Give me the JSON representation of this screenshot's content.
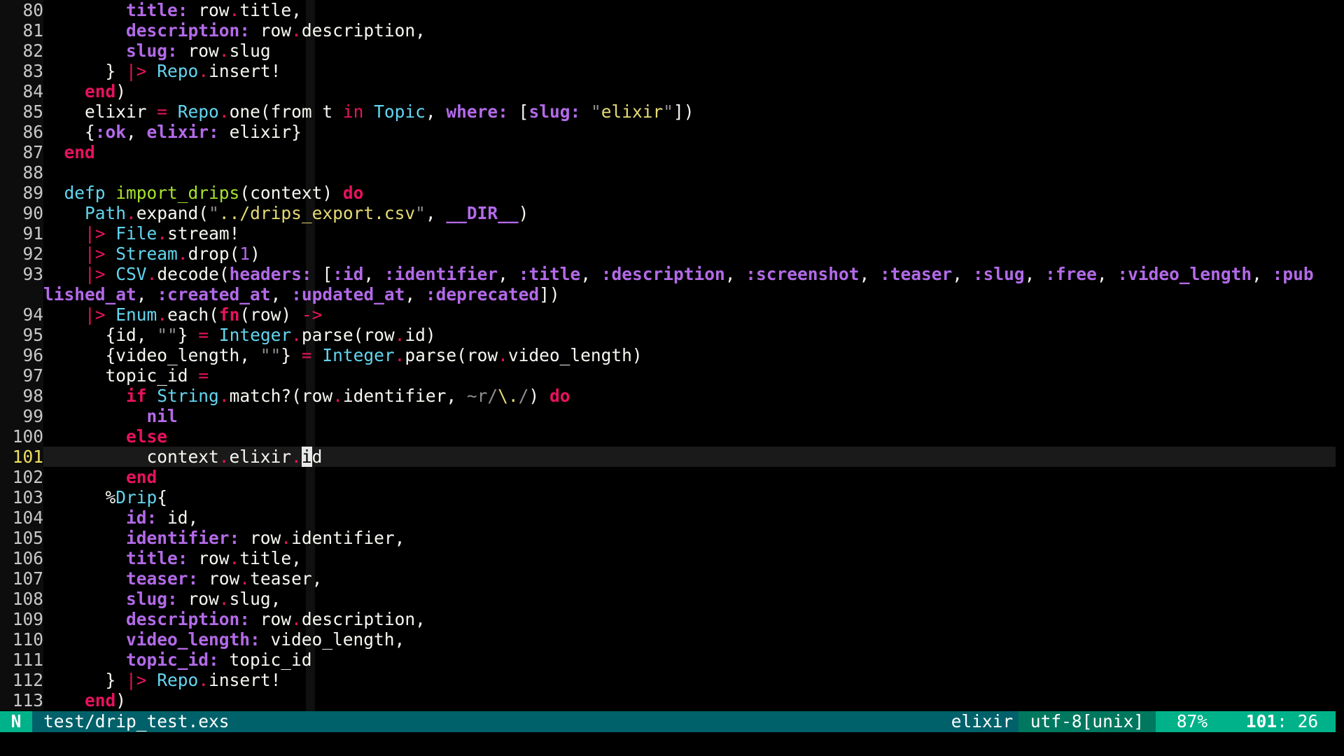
{
  "lines": [
    {
      "num": "80",
      "parts": [
        [
          "txt",
          "        "
        ],
        [
          "key",
          "title:"
        ],
        [
          "txt",
          " row"
        ],
        [
          "dot",
          "."
        ],
        [
          "txt",
          "title,"
        ]
      ]
    },
    {
      "num": "81",
      "parts": [
        [
          "txt",
          "        "
        ],
        [
          "key",
          "description:"
        ],
        [
          "txt",
          " row"
        ],
        [
          "dot",
          "."
        ],
        [
          "txt",
          "description,"
        ]
      ]
    },
    {
      "num": "82",
      "parts": [
        [
          "txt",
          "        "
        ],
        [
          "key",
          "slug:"
        ],
        [
          "txt",
          " row"
        ],
        [
          "dot",
          "."
        ],
        [
          "txt",
          "slug"
        ]
      ]
    },
    {
      "num": "83",
      "parts": [
        [
          "txt",
          "      } "
        ],
        [
          "op",
          "|>"
        ],
        [
          "txt",
          " "
        ],
        [
          "mod",
          "Repo"
        ],
        [
          "dot",
          "."
        ],
        [
          "txt",
          "insert!"
        ]
      ]
    },
    {
      "num": "84",
      "parts": [
        [
          "txt",
          "    "
        ],
        [
          "kw",
          "end"
        ],
        [
          "txt",
          ")"
        ]
      ]
    },
    {
      "num": "85",
      "parts": [
        [
          "txt",
          "    elixir "
        ],
        [
          "op",
          "="
        ],
        [
          "txt",
          " "
        ],
        [
          "mod",
          "Repo"
        ],
        [
          "dot",
          "."
        ],
        [
          "txt",
          "one(from t "
        ],
        [
          "op",
          "in"
        ],
        [
          "txt",
          " "
        ],
        [
          "mod",
          "Topic"
        ],
        [
          "txt",
          ", "
        ],
        [
          "key",
          "where:"
        ],
        [
          "txt",
          " ["
        ],
        [
          "key",
          "slug:"
        ],
        [
          "txt",
          " "
        ],
        [
          "quote",
          "\""
        ],
        [
          "str",
          "elixir"
        ],
        [
          "quote",
          "\""
        ],
        [
          "txt",
          "])"
        ]
      ]
    },
    {
      "num": "86",
      "parts": [
        [
          "txt",
          "    {"
        ],
        [
          "key",
          ":ok"
        ],
        [
          "txt",
          ", "
        ],
        [
          "key",
          "elixir:"
        ],
        [
          "txt",
          " elixir}"
        ]
      ]
    },
    {
      "num": "87",
      "parts": [
        [
          "txt",
          "  "
        ],
        [
          "kw",
          "end"
        ]
      ]
    },
    {
      "num": "88",
      "parts": []
    },
    {
      "num": "89",
      "parts": [
        [
          "txt",
          "  "
        ],
        [
          "def",
          "defp"
        ],
        [
          "txt",
          " "
        ],
        [
          "fn",
          "import_drips"
        ],
        [
          "txt",
          "(context) "
        ],
        [
          "kw",
          "do"
        ]
      ]
    },
    {
      "num": "90",
      "parts": [
        [
          "txt",
          "    "
        ],
        [
          "mod",
          "Path"
        ],
        [
          "dot",
          "."
        ],
        [
          "txt",
          "expand("
        ],
        [
          "quote",
          "\""
        ],
        [
          "str",
          "../drips_export.csv"
        ],
        [
          "quote",
          "\""
        ],
        [
          "txt",
          ", "
        ],
        [
          "key",
          "__DIR__"
        ],
        [
          "txt",
          ")"
        ]
      ]
    },
    {
      "num": "91",
      "parts": [
        [
          "txt",
          "    "
        ],
        [
          "op",
          "|>"
        ],
        [
          "txt",
          " "
        ],
        [
          "mod",
          "File"
        ],
        [
          "dot",
          "."
        ],
        [
          "txt",
          "stream!"
        ]
      ]
    },
    {
      "num": "92",
      "parts": [
        [
          "txt",
          "    "
        ],
        [
          "op",
          "|>"
        ],
        [
          "txt",
          " "
        ],
        [
          "mod",
          "Stream"
        ],
        [
          "dot",
          "."
        ],
        [
          "txt",
          "drop("
        ],
        [
          "num",
          "1"
        ],
        [
          "txt",
          ")"
        ]
      ]
    },
    {
      "num": "93",
      "parts": [
        [
          "txt",
          "    "
        ],
        [
          "op",
          "|>"
        ],
        [
          "txt",
          " "
        ],
        [
          "mod",
          "CSV"
        ],
        [
          "dot",
          "."
        ],
        [
          "txt",
          "decode("
        ],
        [
          "key",
          "headers:"
        ],
        [
          "txt",
          " ["
        ],
        [
          "key",
          ":id"
        ],
        [
          "txt",
          ", "
        ],
        [
          "key",
          ":identifier"
        ],
        [
          "txt",
          ", "
        ],
        [
          "key",
          ":title"
        ],
        [
          "txt",
          ", "
        ],
        [
          "key",
          ":description"
        ],
        [
          "txt",
          ", "
        ],
        [
          "key",
          ":screenshot"
        ],
        [
          "txt",
          ", "
        ],
        [
          "key",
          ":teaser"
        ],
        [
          "txt",
          ", "
        ],
        [
          "key",
          ":slug"
        ],
        [
          "txt",
          ", "
        ],
        [
          "key",
          ":free"
        ],
        [
          "txt",
          ", "
        ],
        [
          "key",
          ":video_length"
        ],
        [
          "txt",
          ", "
        ],
        [
          "key",
          ":pub"
        ]
      ]
    },
    {
      "num": "",
      "parts": [
        [
          "key",
          "lished_at"
        ],
        [
          "txt",
          ", "
        ],
        [
          "key",
          ":created_at"
        ],
        [
          "txt",
          ", "
        ],
        [
          "key",
          ":updated_at"
        ],
        [
          "txt",
          ", "
        ],
        [
          "key",
          ":deprecated"
        ],
        [
          "txt",
          "])"
        ]
      ]
    },
    {
      "num": "94",
      "parts": [
        [
          "txt",
          "    "
        ],
        [
          "op",
          "|>"
        ],
        [
          "txt",
          " "
        ],
        [
          "mod",
          "Enum"
        ],
        [
          "dot",
          "."
        ],
        [
          "txt",
          "each("
        ],
        [
          "kw",
          "fn"
        ],
        [
          "txt",
          "(row) "
        ],
        [
          "op",
          "->"
        ]
      ]
    },
    {
      "num": "95",
      "parts": [
        [
          "txt",
          "      {id, "
        ],
        [
          "quote",
          "\"\""
        ],
        [
          "txt",
          "} "
        ],
        [
          "op",
          "="
        ],
        [
          "txt",
          " "
        ],
        [
          "mod",
          "Integer"
        ],
        [
          "dot",
          "."
        ],
        [
          "txt",
          "parse(row"
        ],
        [
          "dot",
          "."
        ],
        [
          "txt",
          "id)"
        ]
      ]
    },
    {
      "num": "96",
      "parts": [
        [
          "txt",
          "      {video_length, "
        ],
        [
          "quote",
          "\"\""
        ],
        [
          "txt",
          "} "
        ],
        [
          "op",
          "="
        ],
        [
          "txt",
          " "
        ],
        [
          "mod",
          "Integer"
        ],
        [
          "dot",
          "."
        ],
        [
          "txt",
          "parse(row"
        ],
        [
          "dot",
          "."
        ],
        [
          "txt",
          "video_length)"
        ]
      ]
    },
    {
      "num": "97",
      "parts": [
        [
          "txt",
          "      topic_id "
        ],
        [
          "op",
          "="
        ]
      ]
    },
    {
      "num": "98",
      "parts": [
        [
          "txt",
          "        "
        ],
        [
          "kw",
          "if"
        ],
        [
          "txt",
          " "
        ],
        [
          "mod",
          "String"
        ],
        [
          "dot",
          "."
        ],
        [
          "txt",
          "match?(row"
        ],
        [
          "dot",
          "."
        ],
        [
          "txt",
          "identifier, "
        ],
        [
          "sig",
          "~r/"
        ],
        [
          "str",
          "\\."
        ],
        [
          "sig",
          "/"
        ],
        [
          "txt",
          ") "
        ],
        [
          "kw",
          "do"
        ]
      ]
    },
    {
      "num": "99",
      "parts": [
        [
          "txt",
          "          "
        ],
        [
          "key",
          "nil"
        ]
      ]
    },
    {
      "num": "100",
      "parts": [
        [
          "txt",
          "        "
        ],
        [
          "kw",
          "else"
        ]
      ]
    },
    {
      "num": "101",
      "current": true,
      "parts": [
        [
          "txt",
          "          context"
        ],
        [
          "dot",
          "."
        ],
        [
          "txt",
          "elixir"
        ],
        [
          "dot",
          "."
        ],
        [
          "cur",
          "i"
        ],
        [
          "txt",
          "d"
        ]
      ]
    },
    {
      "num": "102",
      "parts": [
        [
          "txt",
          "        "
        ],
        [
          "kw",
          "end"
        ]
      ]
    },
    {
      "num": "103",
      "parts": [
        [
          "txt",
          "      %"
        ],
        [
          "mod",
          "Drip"
        ],
        [
          "txt",
          "{"
        ]
      ]
    },
    {
      "num": "104",
      "parts": [
        [
          "txt",
          "        "
        ],
        [
          "key",
          "id:"
        ],
        [
          "txt",
          " id,"
        ]
      ]
    },
    {
      "num": "105",
      "parts": [
        [
          "txt",
          "        "
        ],
        [
          "key",
          "identifier:"
        ],
        [
          "txt",
          " row"
        ],
        [
          "dot",
          "."
        ],
        [
          "txt",
          "identifier,"
        ]
      ]
    },
    {
      "num": "106",
      "parts": [
        [
          "txt",
          "        "
        ],
        [
          "key",
          "title:"
        ],
        [
          "txt",
          " row"
        ],
        [
          "dot",
          "."
        ],
        [
          "txt",
          "title,"
        ]
      ]
    },
    {
      "num": "107",
      "parts": [
        [
          "txt",
          "        "
        ],
        [
          "key",
          "teaser:"
        ],
        [
          "txt",
          " row"
        ],
        [
          "dot",
          "."
        ],
        [
          "txt",
          "teaser,"
        ]
      ]
    },
    {
      "num": "108",
      "parts": [
        [
          "txt",
          "        "
        ],
        [
          "key",
          "slug:"
        ],
        [
          "txt",
          " row"
        ],
        [
          "dot",
          "."
        ],
        [
          "txt",
          "slug,"
        ]
      ]
    },
    {
      "num": "109",
      "parts": [
        [
          "txt",
          "        "
        ],
        [
          "key",
          "description:"
        ],
        [
          "txt",
          " row"
        ],
        [
          "dot",
          "."
        ],
        [
          "txt",
          "description,"
        ]
      ]
    },
    {
      "num": "110",
      "parts": [
        [
          "txt",
          "        "
        ],
        [
          "key",
          "video_length:"
        ],
        [
          "txt",
          " video_length,"
        ]
      ]
    },
    {
      "num": "111",
      "parts": [
        [
          "txt",
          "        "
        ],
        [
          "key",
          "topic_id:"
        ],
        [
          "txt",
          " topic_id"
        ]
      ]
    },
    {
      "num": "112",
      "parts": [
        [
          "txt",
          "      } "
        ],
        [
          "op",
          "|>"
        ],
        [
          "txt",
          " "
        ],
        [
          "mod",
          "Repo"
        ],
        [
          "dot",
          "."
        ],
        [
          "txt",
          "insert!"
        ]
      ]
    },
    {
      "num": "113",
      "parts": [
        [
          "txt",
          "    "
        ],
        [
          "kw",
          "end"
        ],
        [
          "txt",
          ")"
        ]
      ]
    }
  ],
  "statusline": {
    "mode": "N",
    "filename": "test/drip_test.exs",
    "filetype": "elixir",
    "encoding": "utf-8[unix]",
    "percent": "87%",
    "line": "101",
    "col": ": 26"
  },
  "colors": {
    "background": "#000000",
    "keyword": "#e8125e",
    "atom": "#b36ae8",
    "module": "#62d6f0",
    "function": "#a6e22e",
    "string": "#e6db74",
    "statusline": "#00616a",
    "statusline_accent": "#00b28a"
  }
}
